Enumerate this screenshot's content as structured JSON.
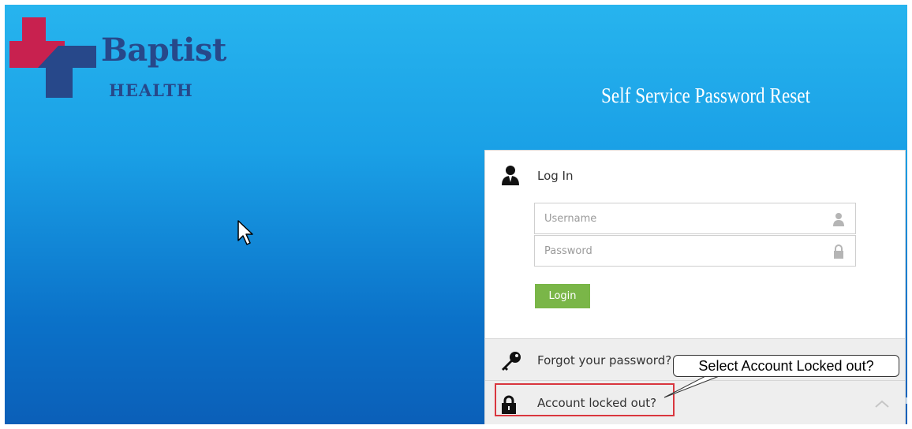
{
  "brand": {
    "name": "Baptist",
    "subtitle": "HEALTH",
    "colors": {
      "navy": "#27488a",
      "crimson": "#c8214f",
      "logo_blue": "#27488a"
    }
  },
  "app_title": "Self Service Password Reset",
  "login": {
    "header_icon": "user-icon",
    "title": "Log In",
    "username": {
      "placeholder": "Username",
      "value": "",
      "icon": "user-icon"
    },
    "password": {
      "placeholder": "Password",
      "value": "",
      "icon": "lock-icon"
    },
    "button_label": "Login",
    "button_color": "#7ab648"
  },
  "options": [
    {
      "icon": "key-icon",
      "label": "Forgot your password?"
    },
    {
      "icon": "lock-icon",
      "label": "Account locked out?",
      "expand_icon": "chevron-up-icon"
    }
  ],
  "annotation": {
    "callout_text": "Select Account Locked out?",
    "highlight_color": "#d9363e"
  },
  "background": {
    "top": "#27b4ee",
    "bottom": "#0b5fb8"
  }
}
